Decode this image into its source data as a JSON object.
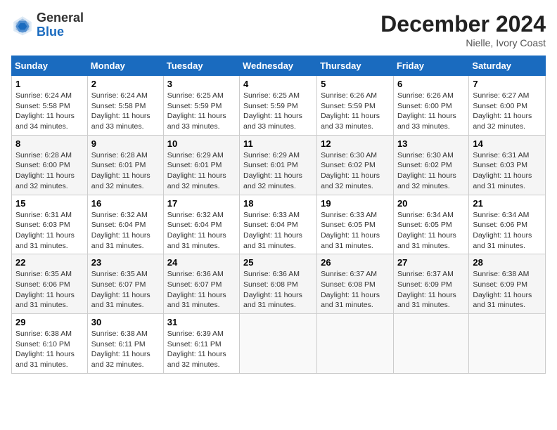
{
  "logo": {
    "general": "General",
    "blue": "Blue"
  },
  "title": "December 2024",
  "location": "Nielle, Ivory Coast",
  "calendar": {
    "headers": [
      "Sunday",
      "Monday",
      "Tuesday",
      "Wednesday",
      "Thursday",
      "Friday",
      "Saturday"
    ],
    "weeks": [
      [
        {
          "day": "1",
          "sunrise": "6:24 AM",
          "sunset": "5:58 PM",
          "daylight": "11 hours and 34 minutes."
        },
        {
          "day": "2",
          "sunrise": "6:24 AM",
          "sunset": "5:58 PM",
          "daylight": "11 hours and 33 minutes."
        },
        {
          "day": "3",
          "sunrise": "6:25 AM",
          "sunset": "5:59 PM",
          "daylight": "11 hours and 33 minutes."
        },
        {
          "day": "4",
          "sunrise": "6:25 AM",
          "sunset": "5:59 PM",
          "daylight": "11 hours and 33 minutes."
        },
        {
          "day": "5",
          "sunrise": "6:26 AM",
          "sunset": "5:59 PM",
          "daylight": "11 hours and 33 minutes."
        },
        {
          "day": "6",
          "sunrise": "6:26 AM",
          "sunset": "6:00 PM",
          "daylight": "11 hours and 33 minutes."
        },
        {
          "day": "7",
          "sunrise": "6:27 AM",
          "sunset": "6:00 PM",
          "daylight": "11 hours and 32 minutes."
        }
      ],
      [
        {
          "day": "8",
          "sunrise": "6:28 AM",
          "sunset": "6:00 PM",
          "daylight": "11 hours and 32 minutes."
        },
        {
          "day": "9",
          "sunrise": "6:28 AM",
          "sunset": "6:01 PM",
          "daylight": "11 hours and 32 minutes."
        },
        {
          "day": "10",
          "sunrise": "6:29 AM",
          "sunset": "6:01 PM",
          "daylight": "11 hours and 32 minutes."
        },
        {
          "day": "11",
          "sunrise": "6:29 AM",
          "sunset": "6:01 PM",
          "daylight": "11 hours and 32 minutes."
        },
        {
          "day": "12",
          "sunrise": "6:30 AM",
          "sunset": "6:02 PM",
          "daylight": "11 hours and 32 minutes."
        },
        {
          "day": "13",
          "sunrise": "6:30 AM",
          "sunset": "6:02 PM",
          "daylight": "11 hours and 32 minutes."
        },
        {
          "day": "14",
          "sunrise": "6:31 AM",
          "sunset": "6:03 PM",
          "daylight": "11 hours and 31 minutes."
        }
      ],
      [
        {
          "day": "15",
          "sunrise": "6:31 AM",
          "sunset": "6:03 PM",
          "daylight": "11 hours and 31 minutes."
        },
        {
          "day": "16",
          "sunrise": "6:32 AM",
          "sunset": "6:04 PM",
          "daylight": "11 hours and 31 minutes."
        },
        {
          "day": "17",
          "sunrise": "6:32 AM",
          "sunset": "6:04 PM",
          "daylight": "11 hours and 31 minutes."
        },
        {
          "day": "18",
          "sunrise": "6:33 AM",
          "sunset": "6:04 PM",
          "daylight": "11 hours and 31 minutes."
        },
        {
          "day": "19",
          "sunrise": "6:33 AM",
          "sunset": "6:05 PM",
          "daylight": "11 hours and 31 minutes."
        },
        {
          "day": "20",
          "sunrise": "6:34 AM",
          "sunset": "6:05 PM",
          "daylight": "11 hours and 31 minutes."
        },
        {
          "day": "21",
          "sunrise": "6:34 AM",
          "sunset": "6:06 PM",
          "daylight": "11 hours and 31 minutes."
        }
      ],
      [
        {
          "day": "22",
          "sunrise": "6:35 AM",
          "sunset": "6:06 PM",
          "daylight": "11 hours and 31 minutes."
        },
        {
          "day": "23",
          "sunrise": "6:35 AM",
          "sunset": "6:07 PM",
          "daylight": "11 hours and 31 minutes."
        },
        {
          "day": "24",
          "sunrise": "6:36 AM",
          "sunset": "6:07 PM",
          "daylight": "11 hours and 31 minutes."
        },
        {
          "day": "25",
          "sunrise": "6:36 AM",
          "sunset": "6:08 PM",
          "daylight": "11 hours and 31 minutes."
        },
        {
          "day": "26",
          "sunrise": "6:37 AM",
          "sunset": "6:08 PM",
          "daylight": "11 hours and 31 minutes."
        },
        {
          "day": "27",
          "sunrise": "6:37 AM",
          "sunset": "6:09 PM",
          "daylight": "11 hours and 31 minutes."
        },
        {
          "day": "28",
          "sunrise": "6:38 AM",
          "sunset": "6:09 PM",
          "daylight": "11 hours and 31 minutes."
        }
      ],
      [
        {
          "day": "29",
          "sunrise": "6:38 AM",
          "sunset": "6:10 PM",
          "daylight": "11 hours and 31 minutes."
        },
        {
          "day": "30",
          "sunrise": "6:38 AM",
          "sunset": "6:11 PM",
          "daylight": "11 hours and 32 minutes."
        },
        {
          "day": "31",
          "sunrise": "6:39 AM",
          "sunset": "6:11 PM",
          "daylight": "11 hours and 32 minutes."
        },
        null,
        null,
        null,
        null
      ]
    ]
  }
}
